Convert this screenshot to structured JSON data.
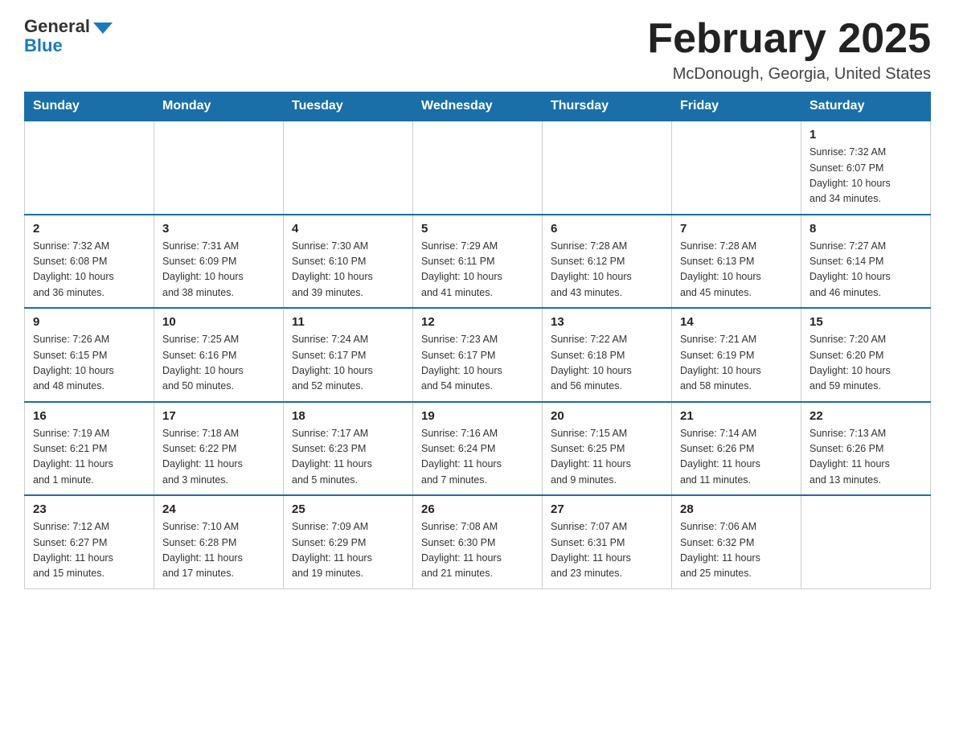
{
  "logo": {
    "general": "General",
    "blue": "Blue"
  },
  "header": {
    "month_title": "February 2025",
    "location": "McDonough, Georgia, United States"
  },
  "weekdays": [
    "Sunday",
    "Monday",
    "Tuesday",
    "Wednesday",
    "Thursday",
    "Friday",
    "Saturday"
  ],
  "weeks": [
    [
      {
        "day": "",
        "info": ""
      },
      {
        "day": "",
        "info": ""
      },
      {
        "day": "",
        "info": ""
      },
      {
        "day": "",
        "info": ""
      },
      {
        "day": "",
        "info": ""
      },
      {
        "day": "",
        "info": ""
      },
      {
        "day": "1",
        "info": "Sunrise: 7:32 AM\nSunset: 6:07 PM\nDaylight: 10 hours\nand 34 minutes."
      }
    ],
    [
      {
        "day": "2",
        "info": "Sunrise: 7:32 AM\nSunset: 6:08 PM\nDaylight: 10 hours\nand 36 minutes."
      },
      {
        "day": "3",
        "info": "Sunrise: 7:31 AM\nSunset: 6:09 PM\nDaylight: 10 hours\nand 38 minutes."
      },
      {
        "day": "4",
        "info": "Sunrise: 7:30 AM\nSunset: 6:10 PM\nDaylight: 10 hours\nand 39 minutes."
      },
      {
        "day": "5",
        "info": "Sunrise: 7:29 AM\nSunset: 6:11 PM\nDaylight: 10 hours\nand 41 minutes."
      },
      {
        "day": "6",
        "info": "Sunrise: 7:28 AM\nSunset: 6:12 PM\nDaylight: 10 hours\nand 43 minutes."
      },
      {
        "day": "7",
        "info": "Sunrise: 7:28 AM\nSunset: 6:13 PM\nDaylight: 10 hours\nand 45 minutes."
      },
      {
        "day": "8",
        "info": "Sunrise: 7:27 AM\nSunset: 6:14 PM\nDaylight: 10 hours\nand 46 minutes."
      }
    ],
    [
      {
        "day": "9",
        "info": "Sunrise: 7:26 AM\nSunset: 6:15 PM\nDaylight: 10 hours\nand 48 minutes."
      },
      {
        "day": "10",
        "info": "Sunrise: 7:25 AM\nSunset: 6:16 PM\nDaylight: 10 hours\nand 50 minutes."
      },
      {
        "day": "11",
        "info": "Sunrise: 7:24 AM\nSunset: 6:17 PM\nDaylight: 10 hours\nand 52 minutes."
      },
      {
        "day": "12",
        "info": "Sunrise: 7:23 AM\nSunset: 6:17 PM\nDaylight: 10 hours\nand 54 minutes."
      },
      {
        "day": "13",
        "info": "Sunrise: 7:22 AM\nSunset: 6:18 PM\nDaylight: 10 hours\nand 56 minutes."
      },
      {
        "day": "14",
        "info": "Sunrise: 7:21 AM\nSunset: 6:19 PM\nDaylight: 10 hours\nand 58 minutes."
      },
      {
        "day": "15",
        "info": "Sunrise: 7:20 AM\nSunset: 6:20 PM\nDaylight: 10 hours\nand 59 minutes."
      }
    ],
    [
      {
        "day": "16",
        "info": "Sunrise: 7:19 AM\nSunset: 6:21 PM\nDaylight: 11 hours\nand 1 minute."
      },
      {
        "day": "17",
        "info": "Sunrise: 7:18 AM\nSunset: 6:22 PM\nDaylight: 11 hours\nand 3 minutes."
      },
      {
        "day": "18",
        "info": "Sunrise: 7:17 AM\nSunset: 6:23 PM\nDaylight: 11 hours\nand 5 minutes."
      },
      {
        "day": "19",
        "info": "Sunrise: 7:16 AM\nSunset: 6:24 PM\nDaylight: 11 hours\nand 7 minutes."
      },
      {
        "day": "20",
        "info": "Sunrise: 7:15 AM\nSunset: 6:25 PM\nDaylight: 11 hours\nand 9 minutes."
      },
      {
        "day": "21",
        "info": "Sunrise: 7:14 AM\nSunset: 6:26 PM\nDaylight: 11 hours\nand 11 minutes."
      },
      {
        "day": "22",
        "info": "Sunrise: 7:13 AM\nSunset: 6:26 PM\nDaylight: 11 hours\nand 13 minutes."
      }
    ],
    [
      {
        "day": "23",
        "info": "Sunrise: 7:12 AM\nSunset: 6:27 PM\nDaylight: 11 hours\nand 15 minutes."
      },
      {
        "day": "24",
        "info": "Sunrise: 7:10 AM\nSunset: 6:28 PM\nDaylight: 11 hours\nand 17 minutes."
      },
      {
        "day": "25",
        "info": "Sunrise: 7:09 AM\nSunset: 6:29 PM\nDaylight: 11 hours\nand 19 minutes."
      },
      {
        "day": "26",
        "info": "Sunrise: 7:08 AM\nSunset: 6:30 PM\nDaylight: 11 hours\nand 21 minutes."
      },
      {
        "day": "27",
        "info": "Sunrise: 7:07 AM\nSunset: 6:31 PM\nDaylight: 11 hours\nand 23 minutes."
      },
      {
        "day": "28",
        "info": "Sunrise: 7:06 AM\nSunset: 6:32 PM\nDaylight: 11 hours\nand 25 minutes."
      },
      {
        "day": "",
        "info": ""
      }
    ]
  ]
}
